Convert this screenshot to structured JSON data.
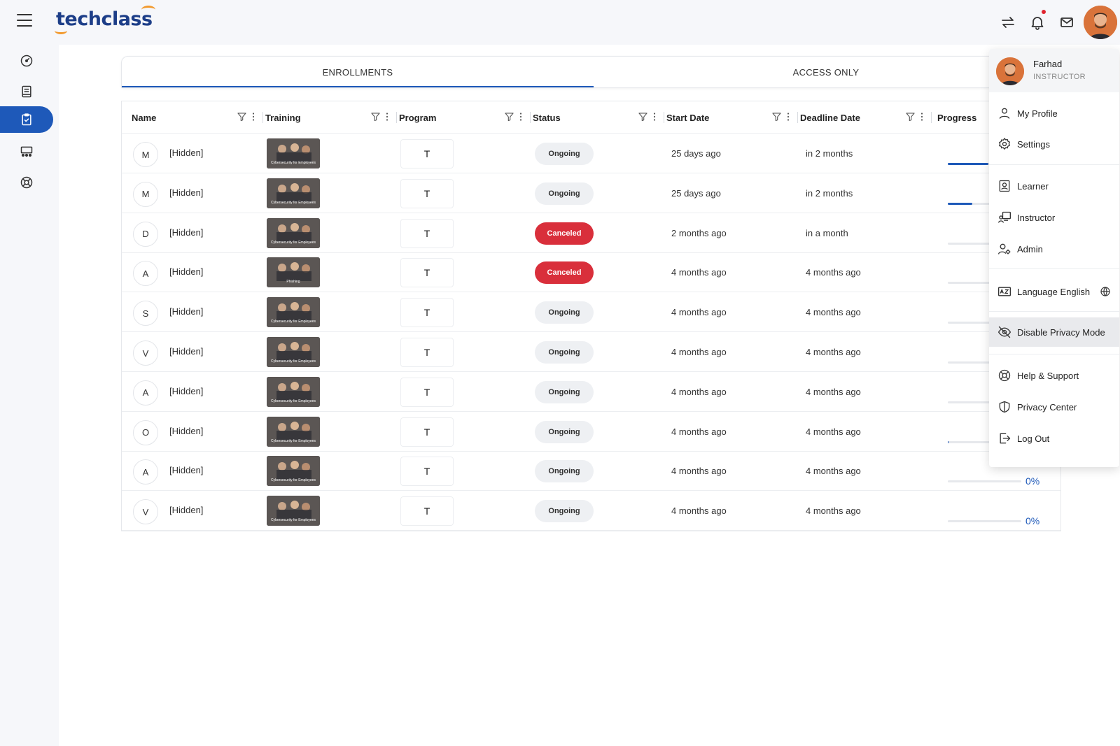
{
  "app": {
    "logo": "techclass"
  },
  "tabs": [
    {
      "label": "ENROLLMENTS",
      "active": true
    },
    {
      "label": "ACCESS ONLY",
      "active": false
    }
  ],
  "table": {
    "columns": [
      "Name",
      "Training",
      "Program",
      "Status",
      "Start Date",
      "Deadline Date",
      "Progress"
    ],
    "rows": [
      {
        "initial": "M",
        "name": "[Hidden]",
        "thumb_caption": "Cybersecurity for Employees",
        "program": "T",
        "status": "Ongoing",
        "start": "25 days ago",
        "deadline": "in 2 months",
        "progress": 0.55,
        "progress_label": ""
      },
      {
        "initial": "M",
        "name": "[Hidden]",
        "thumb_caption": "Cybersecurity for Employees",
        "program": "T",
        "status": "Ongoing",
        "start": "25 days ago",
        "deadline": "in 2 months",
        "progress": 0.33,
        "progress_label": ""
      },
      {
        "initial": "D",
        "name": "[Hidden]",
        "thumb_caption": "Cybersecurity for Employees",
        "program": "T",
        "status": "Canceled",
        "start": "2 months ago",
        "deadline": "in a month",
        "progress": 0,
        "progress_label": ""
      },
      {
        "initial": "A",
        "name": "[Hidden]",
        "thumb_caption": "Phishing",
        "program": "T",
        "status": "Canceled",
        "start": "4 months ago",
        "deadline": "4 months ago",
        "progress": 0,
        "progress_label": ""
      },
      {
        "initial": "S",
        "name": "[Hidden]",
        "thumb_caption": "Cybersecurity for Employees",
        "program": "T",
        "status": "Ongoing",
        "start": "4 months ago",
        "deadline": "4 months ago",
        "progress": 0,
        "progress_label": ""
      },
      {
        "initial": "V",
        "name": "[Hidden]",
        "thumb_caption": "Cybersecurity for Employees",
        "program": "T",
        "status": "Ongoing",
        "start": "4 months ago",
        "deadline": "4 months ago",
        "progress": 0,
        "progress_label": ""
      },
      {
        "initial": "A",
        "name": "[Hidden]",
        "thumb_caption": "Cybersecurity for Employees",
        "program": "T",
        "status": "Ongoing",
        "start": "4 months ago",
        "deadline": "4 months ago",
        "progress": 0,
        "progress_label": ""
      },
      {
        "initial": "O",
        "name": "[Hidden]",
        "thumb_caption": "Cybersecurity for Employees",
        "program": "T",
        "status": "Ongoing",
        "start": "4 months ago",
        "deadline": "4 months ago",
        "progress": 0.01,
        "progress_label": ""
      },
      {
        "initial": "A",
        "name": "[Hidden]",
        "thumb_caption": "Cybersecurity for Employees",
        "program": "T",
        "status": "Ongoing",
        "start": "4 months ago",
        "deadline": "4 months ago",
        "progress": 0,
        "progress_label": "0%"
      },
      {
        "initial": "V",
        "name": "[Hidden]",
        "thumb_caption": "Cybersecurity for Employees",
        "program": "T",
        "status": "Ongoing",
        "start": "4 months ago",
        "deadline": "4 months ago",
        "progress": 0,
        "progress_label": "0%"
      }
    ]
  },
  "user_menu": {
    "name": "Farhad",
    "role": "INSTRUCTOR",
    "items": {
      "my_profile": "My Profile",
      "settings": "Settings",
      "learner": "Learner",
      "instructor": "Instructor",
      "admin": "Admin",
      "language": "Language English",
      "privacy_mode": "Disable Privacy Mode",
      "help": "Help & Support",
      "privacy_center": "Privacy Center",
      "logout": "Log Out"
    }
  },
  "icons": {
    "sidebar": [
      "dashboard-icon",
      "book-icon",
      "clipboard-check-icon",
      "classroom-icon",
      "lifebuoy-icon"
    ],
    "topbar": [
      "swap-icon",
      "bell-icon",
      "mail-icon"
    ]
  },
  "colors": {
    "primary": "#1e59b9",
    "logo_navy": "#1d3e88",
    "logo_orange": "#f29a2e",
    "danger": "#d92f3b"
  }
}
